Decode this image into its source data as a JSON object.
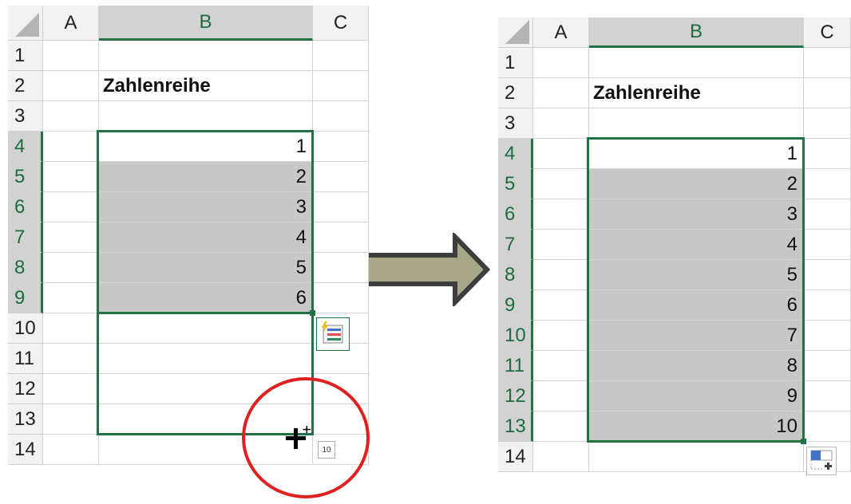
{
  "columns": [
    "A",
    "B",
    "C"
  ],
  "rows": [
    "1",
    "2",
    "3",
    "4",
    "5",
    "6",
    "7",
    "8",
    "9",
    "10",
    "11",
    "12",
    "13",
    "14"
  ],
  "header_cell": "Zahlenreihe",
  "before": {
    "values": [
      "1",
      "2",
      "3",
      "4",
      "5",
      "6"
    ],
    "fill_tooltip": "10"
  },
  "after": {
    "values": [
      "1",
      "2",
      "3",
      "4",
      "5",
      "6",
      "7",
      "8",
      "9",
      "10"
    ]
  },
  "colors": {
    "accent": "#217346",
    "selection_fill": "#c8c8c8",
    "arrow_fill": "#a8a888",
    "arrow_stroke": "#3d3d3d",
    "circle": "#e02020"
  },
  "icons": [
    "flash-fill-icon",
    "crosshair-cursor-icon",
    "autofill-options-icon",
    "right-arrow-icon"
  ]
}
